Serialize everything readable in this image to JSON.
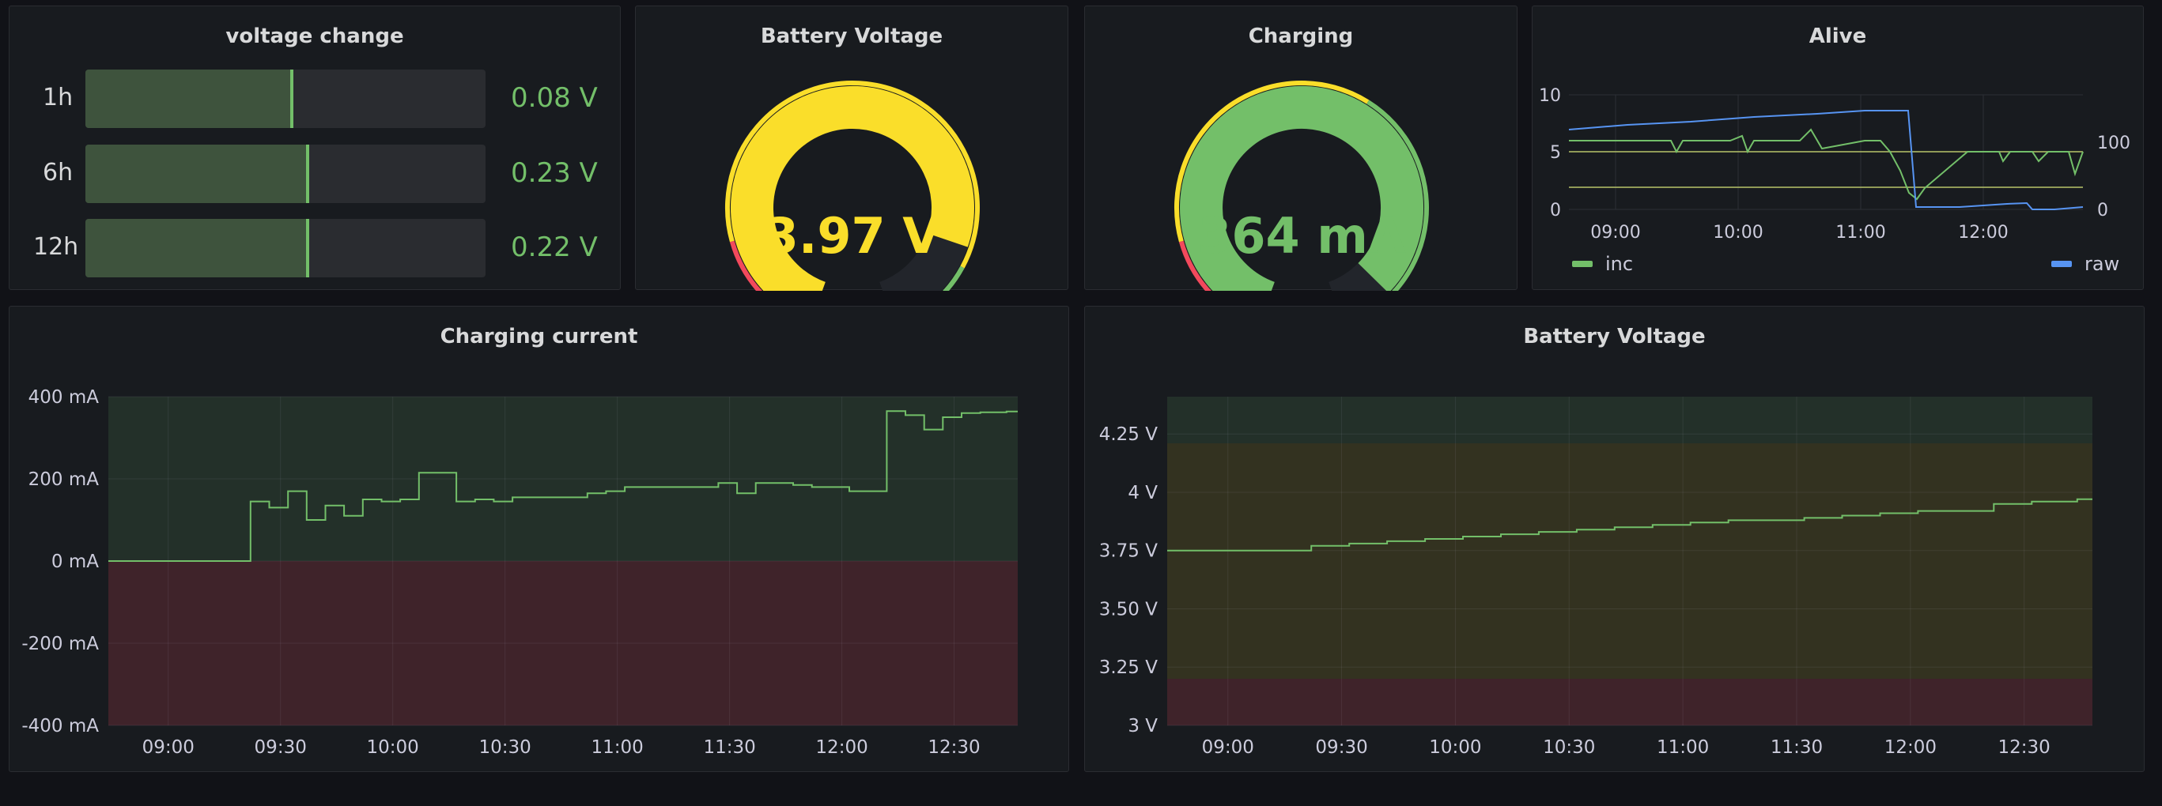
{
  "colors": {
    "green": "#73bf69",
    "yellow": "#fade2a",
    "red": "#f2495c",
    "blue": "#5794f2",
    "bg": "#111217",
    "panel": "#181b1f",
    "text": "#ccccdc"
  },
  "voltage_change": {
    "title": "voltage change",
    "bars": [
      {
        "label": "1h",
        "value": "0.08 V",
        "level": 0.52
      },
      {
        "label": "6h",
        "value": "0.23 V",
        "level": 0.56
      },
      {
        "label": "12h",
        "value": "0.22 V",
        "level": 0.56
      }
    ]
  },
  "battery_gauge": {
    "title": "Battery Voltage",
    "value": "3.97 V",
    "level": 0.84,
    "value_color": "#fade2a"
  },
  "charging_gauge": {
    "title": "Charging",
    "value": "364 mA",
    "level": 0.92,
    "value_color": "#73bf69"
  },
  "alive": {
    "title": "Alive",
    "left_ticks": [
      "10",
      "5",
      "0"
    ],
    "right_ticks": [
      "100",
      "0"
    ],
    "x_ticks": [
      "09:00",
      "10:00",
      "11:00",
      "12:00"
    ],
    "legend": [
      {
        "name": "inc",
        "color": "#73bf69"
      },
      {
        "name": "raw",
        "color": "#5794f2"
      }
    ]
  },
  "charging_current": {
    "title": "Charging current",
    "chart_data": {
      "type": "line",
      "y_ticks": [
        "400 mA",
        "200 mA",
        "0 mA",
        "-200 mA",
        "-400 mA"
      ],
      "x_ticks": [
        "09:00",
        "09:30",
        "10:00",
        "10:30",
        "11:00",
        "11:30",
        "12:00",
        "12:30"
      ],
      "ylim": [
        -400,
        400
      ],
      "x": [
        "08:44",
        "09:22",
        "09:27",
        "09:32",
        "09:37",
        "09:42",
        "09:47",
        "09:52",
        "09:57",
        "10:02",
        "10:07",
        "10:12",
        "10:17",
        "10:22",
        "10:27",
        "10:32",
        "10:37",
        "10:42",
        "10:47",
        "10:52",
        "10:57",
        "11:02",
        "11:07",
        "11:12",
        "11:17",
        "11:22",
        "11:27",
        "11:32",
        "11:37",
        "11:42",
        "11:47",
        "11:52",
        "11:57",
        "12:02",
        "12:07",
        "12:12",
        "12:17",
        "12:22",
        "12:27",
        "12:32",
        "12:37",
        "12:44"
      ],
      "series": [
        {
          "values": [
            0,
            145,
            130,
            170,
            100,
            135,
            110,
            150,
            145,
            150,
            215,
            215,
            145,
            150,
            145,
            155,
            155,
            155,
            155,
            165,
            170,
            180,
            180,
            180,
            180,
            180,
            190,
            165,
            190,
            190,
            185,
            180,
            180,
            170,
            170,
            365,
            355,
            320,
            350,
            360,
            362,
            364
          ]
        }
      ]
    }
  },
  "battery_voltage": {
    "title": "Battery Voltage",
    "chart_data": {
      "type": "line",
      "y_ticks": [
        "4.25 V",
        "4 V",
        "3.75 V",
        "3.50 V",
        "3.25 V",
        "3 V"
      ],
      "x_ticks": [
        "09:00",
        "09:30",
        "10:00",
        "10:30",
        "11:00",
        "11:30",
        "12:00",
        "12:30"
      ],
      "ylim": [
        3.0,
        4.2
      ],
      "x": [
        "08:44",
        "09:12",
        "09:22",
        "09:32",
        "09:42",
        "09:52",
        "10:02",
        "10:12",
        "10:22",
        "10:32",
        "10:42",
        "10:52",
        "11:02",
        "11:12",
        "11:22",
        "11:32",
        "11:42",
        "11:52",
        "12:02",
        "12:12",
        "12:22",
        "12:32",
        "12:44"
      ],
      "series": [
        {
          "values": [
            3.75,
            3.75,
            3.77,
            3.78,
            3.79,
            3.8,
            3.81,
            3.82,
            3.83,
            3.84,
            3.85,
            3.86,
            3.87,
            3.88,
            3.88,
            3.89,
            3.9,
            3.91,
            3.92,
            3.92,
            3.95,
            3.96,
            3.97
          ]
        }
      ]
    }
  }
}
